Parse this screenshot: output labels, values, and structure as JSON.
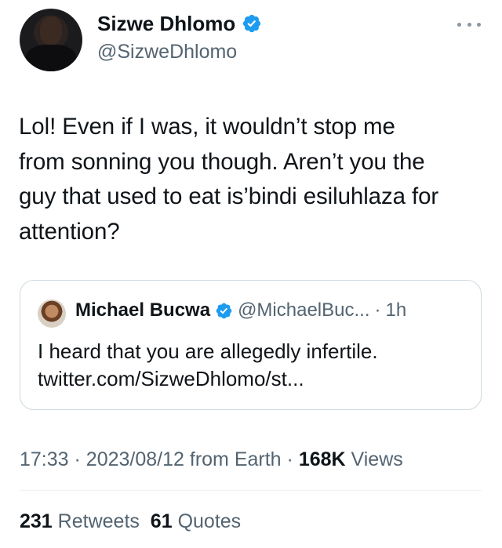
{
  "author": {
    "display_name": "Sizwe Dhlomo",
    "handle": "@SizweDhlomo",
    "verified": true
  },
  "tweet": {
    "text": "Lol! Even if I was, it wouldn’t stop me\nfrom sonning you though. Aren’t you the\nguy that used to eat is’bindi esiluhlaza for\nattention?"
  },
  "quoted_tweet": {
    "display_name": "Michael Bucwa",
    "handle": "@MichaelBuc...",
    "separator": "·",
    "time": "1h",
    "text": "I heard that you are allegedly infertile.\ntwitter.com/SizweDhlomo/st..."
  },
  "meta": {
    "time": "17:33",
    "sep1": "·",
    "date": "2023/08/12",
    "source": "from Earth",
    "sep2": "·",
    "views_count": "168K",
    "views_label": "Views"
  },
  "stats": {
    "retweets_count": "231",
    "retweets_label": "Retweets",
    "quotes_count": "61",
    "quotes_label": "Quotes"
  },
  "colors": {
    "verified_blue": "#1d9bf0",
    "text_primary": "#0f1419",
    "text_secondary": "#536471",
    "border": "#cfd9de"
  },
  "icons": {
    "verified": "verified-badge-icon",
    "more": "more-horizontal-icon"
  }
}
